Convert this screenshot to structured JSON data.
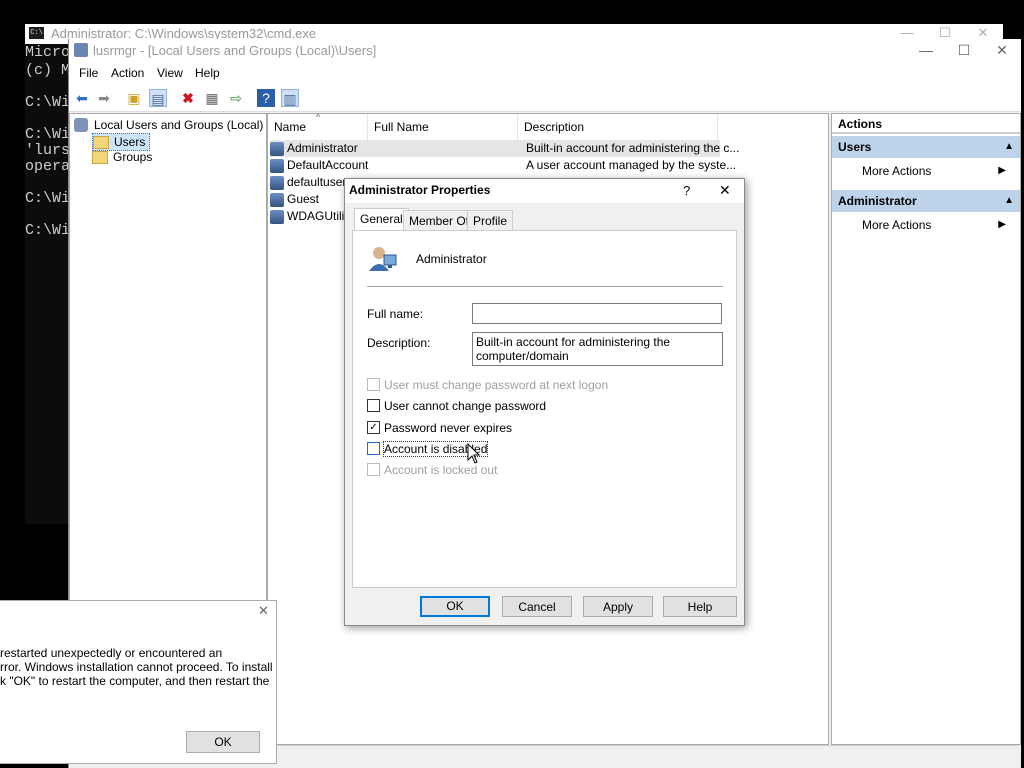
{
  "cmd": {
    "title": "Administrator: C:\\Windows\\system32\\cmd.exe",
    "icon": "C:\\",
    "lines": [
      "Micro",
      "(c) M",
      "",
      "C:\\Wi",
      "",
      "C:\\Wi",
      "'lurs",
      "opera",
      "",
      "C:\\Wi",
      "",
      "C:\\Wi"
    ]
  },
  "mmc": {
    "title": "lusrmgr - [Local Users and Groups (Local)\\Users]",
    "menu": [
      "File",
      "Action",
      "View",
      "Help"
    ],
    "tree": {
      "root": "Local Users and Groups (Local)",
      "children": [
        "Users",
        "Groups"
      ]
    },
    "columns": [
      "Name",
      "Full Name",
      "Description"
    ],
    "users": [
      {
        "name": "Administrator",
        "full_name": "",
        "description": "Built-in account for administering the c..."
      },
      {
        "name": "DefaultAccount",
        "full_name": "",
        "description": "A user account managed by the syste..."
      },
      {
        "name": "defaultuser",
        "full_name": "",
        "description": ""
      },
      {
        "name": "Guest",
        "full_name": "",
        "description": ""
      },
      {
        "name": "WDAGUtilit",
        "full_name": "",
        "description": ""
      }
    ],
    "actions": {
      "header": "Actions",
      "sections": [
        {
          "title": "Users",
          "item": "More Actions"
        },
        {
          "title": "Administrator",
          "item": "More Actions"
        }
      ]
    }
  },
  "setup_dialog": {
    "lines": [
      "restarted unexpectedly or encountered an",
      "rror. Windows installation cannot proceed. To install",
      "k \"OK\" to restart the computer, and then restart the"
    ],
    "ok": "OK"
  },
  "props": {
    "title": "Administrator Properties",
    "help": "?",
    "close": "✕",
    "tabs": [
      "General",
      "Member Of",
      "Profile"
    ],
    "user_name": "Administrator",
    "full_name_label": "Full name:",
    "full_name_value": "",
    "description_label": "Description:",
    "description_value": "Built-in account for administering the computer/domain",
    "checkboxes": [
      {
        "label": "User must change password at next logon",
        "checked": false,
        "disabled": true
      },
      {
        "label": "User cannot change password",
        "checked": false,
        "disabled": false
      },
      {
        "label": "Password never expires",
        "checked": true,
        "disabled": false
      },
      {
        "label": "Account is disabled",
        "checked": false,
        "disabled": false
      },
      {
        "label": "Account is locked out",
        "checked": false,
        "disabled": true
      }
    ],
    "buttons": {
      "ok": "OK",
      "cancel": "Cancel",
      "apply": "Apply",
      "help": "Help"
    }
  }
}
